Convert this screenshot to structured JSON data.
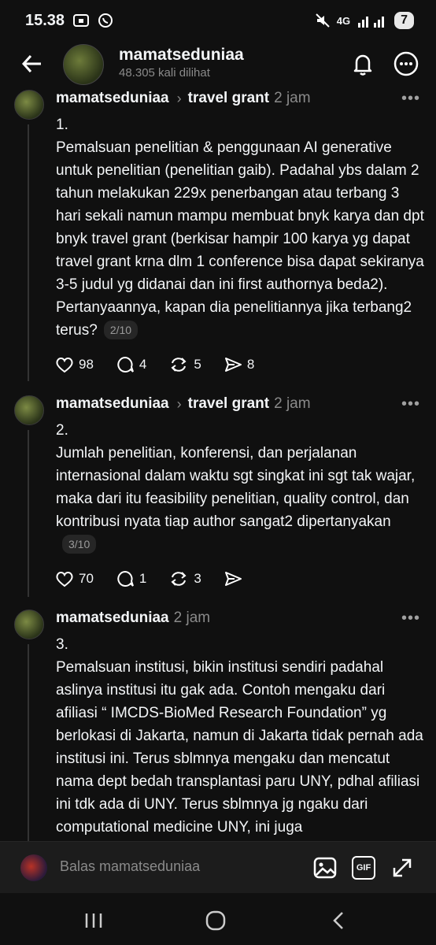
{
  "status_bar": {
    "time": "15.38",
    "network": "4G",
    "battery": "7"
  },
  "header": {
    "username": "mamatseduniaa",
    "views": "48.305 kali dilihat",
    "icons": [
      "back-arrow-icon",
      "bell-icon",
      "more-icon"
    ]
  },
  "posts": [
    {
      "username": "mamatseduniaa",
      "topic": "travel grant",
      "time": "2 jam",
      "number": "1.",
      "text": "Pemalsuan penelitian & penggunaan AI generative untuk penelitian (penelitian gaib). Padahal ybs dalam 2 tahun melakukan 229x penerbangan atau terbang 3 hari sekali namun mampu membuat bnyk karya dan dpt bnyk travel grant (berkisar hampir 100 karya yg dapat travel grant krna dlm 1 conference bisa dapat sekiranya 3-5 judul yg didanai dan ini first authornya beda2). Pertanyaannya, kapan dia penelitiannya jika terbang2 terus?",
      "counter": "2/10",
      "likes": "98",
      "replies": "4",
      "reposts": "5",
      "shares": "8"
    },
    {
      "username": "mamatseduniaa",
      "topic": "travel grant",
      "time": "2 jam",
      "number": "2.",
      "text": "Jumlah penelitian, konferensi, dan perjalanan internasional dalam waktu sgt singkat ini sgt tak wajar, maka dari itu feasibility penelitian, quality control, dan kontribusi nyata tiap author sangat2 dipertanyakan",
      "counter": "3/10",
      "likes": "70",
      "replies": "1",
      "reposts": "3",
      "shares": ""
    },
    {
      "username": "mamatseduniaa",
      "time": "2 jam",
      "number": "3.",
      "text": "Pemalsuan institusi, bikin institusi sendiri padahal aslinya institusi itu gak ada. Contoh mengaku dari afiliasi “ IMCDS-BioMed Research Foundation” yg berlokasi di Jakarta, namun di Jakarta tidak pernah ada institusi ini. Terus sblmnya mengaku dan mencatut nama dept bedah transplantasi paru UNY, pdhal afiliasi ini tdk ada di UNY. Terus sblmnya jg ngaku dari computational medicine UNY, ini juga"
    }
  ],
  "reply_bar": {
    "placeholder": "Balas mamatseduniaa",
    "gif_label": "GIF"
  },
  "colors": {
    "background": "#101010",
    "text": "#f3f5f7",
    "muted": "#8a8a8a"
  }
}
